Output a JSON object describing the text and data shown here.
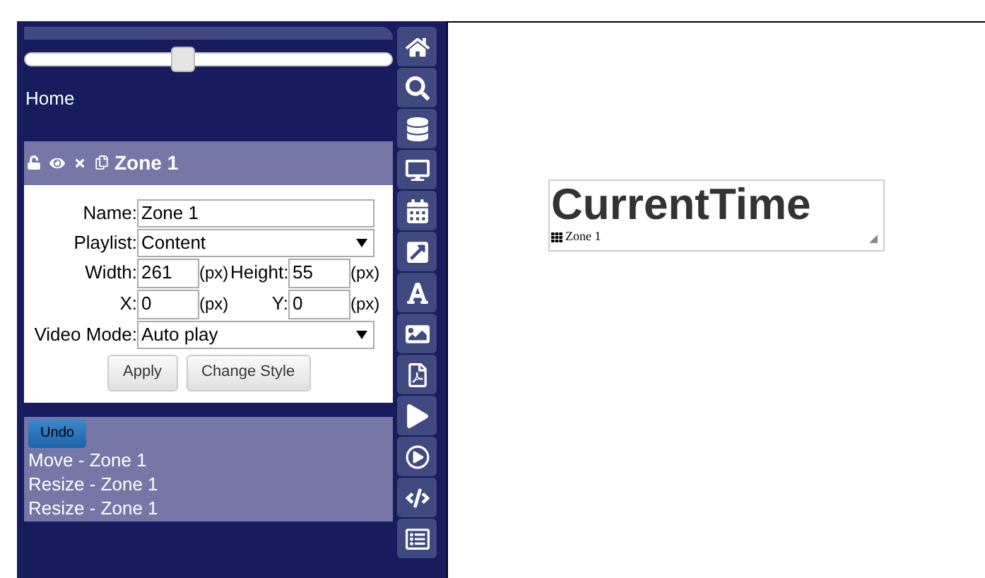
{
  "zoom_slider": {
    "level": 0.43
  },
  "breadcrumb": "Home",
  "zone_panel": {
    "title": "Zone 1",
    "locked": false,
    "fields": [
      {
        "kind": "text",
        "label": "Name:",
        "value": "Zone 1"
      },
      {
        "kind": "select",
        "label": "Playlist:",
        "value": "Content"
      },
      {
        "kind": "pair",
        "label": "Width:",
        "value": "261",
        "unit": "(px)",
        "label2": "Height:",
        "value2": "55",
        "unit2": "(px)"
      },
      {
        "kind": "pair",
        "label": "X:",
        "value": "0",
        "unit": "(px)",
        "label2": "Y:",
        "value2": "0",
        "unit2": "(px)"
      },
      {
        "kind": "select",
        "label": "Video Mode:",
        "value": "Auto play"
      }
    ],
    "buttons": [
      "Apply",
      "Change Style"
    ]
  },
  "history": {
    "undo": "Undo",
    "entries": [
      "Move - Zone 1",
      "Resize - Zone 1",
      "Resize - Zone 1"
    ]
  },
  "canvas": {
    "widget": {
      "text": "CurrentTime",
      "label": "Zone 1"
    }
  }
}
